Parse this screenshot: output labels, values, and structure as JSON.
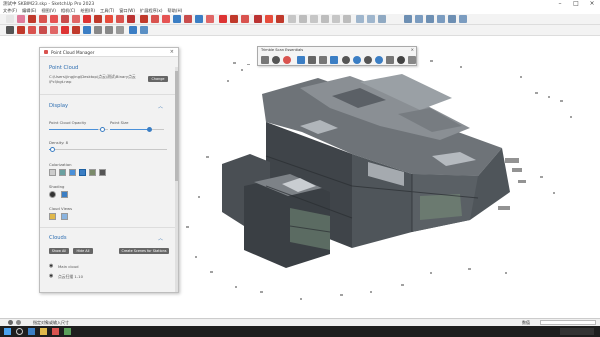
{
  "app": {
    "title": "测试中 SKBIM23.skp - SketchUp Pro 2023"
  },
  "menu": [
    "文件(F)",
    "编辑(E)",
    "视图(V)",
    "相机(C)",
    "绘图(R)",
    "工具(T)",
    "窗口(W)",
    "扩展程序(x)",
    "帮助(H)"
  ],
  "point_cloud_manager": {
    "title": "Point Cloud Manager",
    "section_title": "Point Cloud",
    "path": "C:\\Users\\jingjing\\Desktop\\点云\\测试\\Binary点云\\Pcl\\kgt.rwp",
    "change_label": "Change",
    "display_title": "Display",
    "opacity_label": "Point Cloud Opacity",
    "opacity_value": 0.78,
    "size_label": "Point Size",
    "size_value": 0.82,
    "density_label": "Density: 8",
    "density_value": 0.02,
    "colorization_label": "Colorization",
    "shading_label": "Shading",
    "cloud_views_label": "Cloud Views",
    "clouds_title": "Clouds",
    "show_all_label": "Show All",
    "hide_all_label": "Hide All",
    "create_scenes_label": "Create Scenes for Stations",
    "cloud_items": [
      "Main cloud",
      "点云扫描 1-10"
    ]
  },
  "scan_panel": {
    "title": "Trimble Scan Essentials"
  },
  "status": {
    "hint": "指定对象或输入尺寸",
    "measurement_label": "数值"
  },
  "colors": {
    "accent": "#2b6cb0",
    "toolbar_bg": "#f3f3f3",
    "taskbar": "#1e1e1e"
  }
}
